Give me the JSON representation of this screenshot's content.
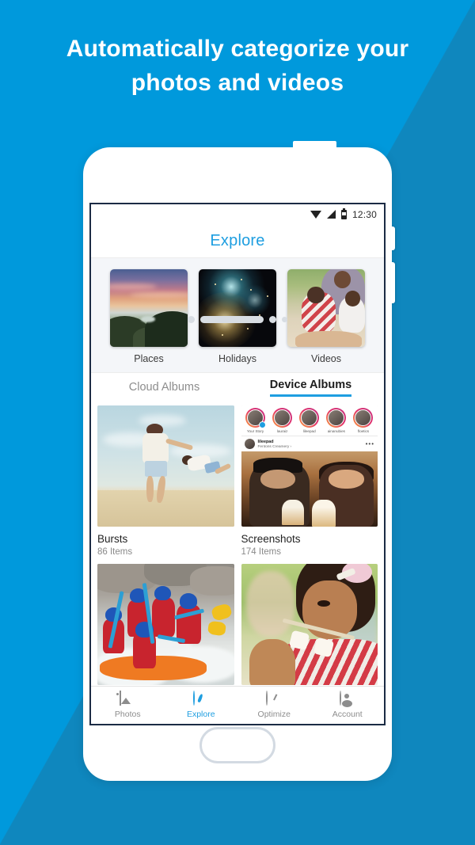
{
  "promo": {
    "headline_line1": "Automatically categorize your",
    "headline_line2": "photos and videos",
    "bg_color": "#0099dc",
    "shadow_color": "#0f87be"
  },
  "statusbar": {
    "wifi_icon": "wifi-icon",
    "signal_icon": "signal-icon",
    "battery_icon": "battery-icon",
    "time": "12:30"
  },
  "app": {
    "title": "Explore",
    "accent_color": "#1e9ee0"
  },
  "categories": [
    {
      "label": "Places",
      "art": "sunset-landscape"
    },
    {
      "label": "Holidays",
      "art": "fireworks"
    },
    {
      "label": "Videos",
      "art": "family-outdoors"
    }
  ],
  "tabs": [
    {
      "label": "Cloud Albums",
      "active": false
    },
    {
      "label": "Device Albums",
      "active": true
    }
  ],
  "albums": [
    {
      "name": "Bursts",
      "count": "86 Items",
      "art": "beach-father-child"
    },
    {
      "name": "Screenshots",
      "count": "174 Items",
      "art": "instagram-screenshot"
    },
    {
      "name": "",
      "count": "",
      "art": "whitewater-rafting"
    },
    {
      "name": "",
      "count": "",
      "art": "girl-with-marshmallows"
    }
  ],
  "screenshot_content": {
    "stories": [
      "Your Story",
      "lauraiz",
      "lileepad",
      "ainanubies",
      "floetics"
    ],
    "post_user": "lileepad",
    "post_location": "Fentons Creamery ›",
    "more_icon": "ellipsis-icon"
  },
  "bottom_nav": [
    {
      "label": "Photos",
      "icon": "photos-icon",
      "active": false
    },
    {
      "label": "Explore",
      "icon": "compass-icon",
      "active": true
    },
    {
      "label": "Optimize",
      "icon": "gauge-icon",
      "active": false
    },
    {
      "label": "Account",
      "icon": "account-icon",
      "active": false
    }
  ]
}
